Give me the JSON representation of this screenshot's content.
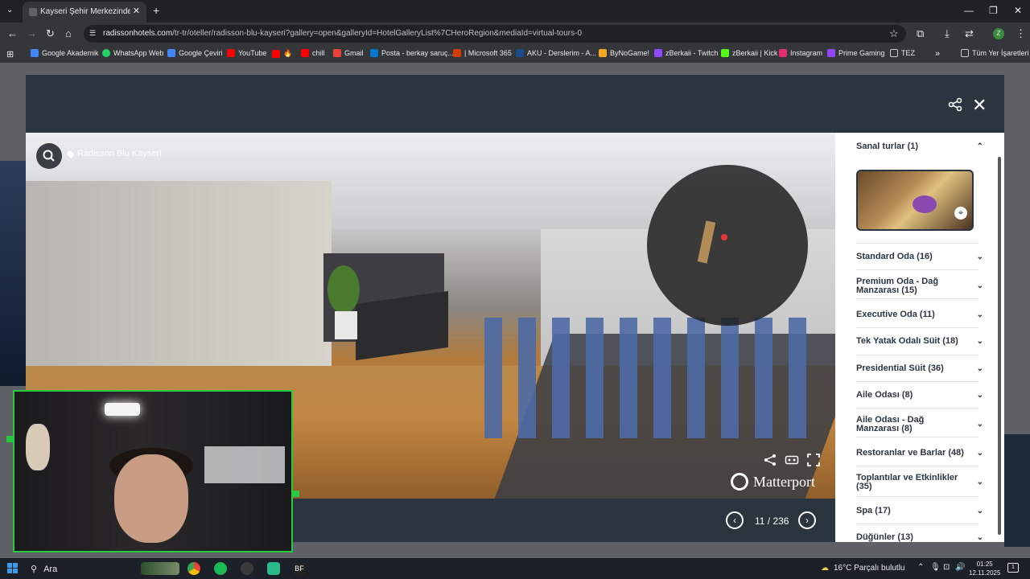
{
  "browser": {
    "tab_title": "Kayseri Şehir Merkezindeki Ot",
    "new_tab": "+",
    "url_host": "radissonhotels.com",
    "url_path": "/tr-tr/oteller/radisson-blu-kayseri?gallery=open&galleryId=HotelGalleryList%7CHeroRegion&mediaId=virtual-tours-0",
    "profile_initial": "Z"
  },
  "bookmarks": [
    {
      "label": "Google Akademik",
      "icon": "google-scholar-icon",
      "color": "#4285f4"
    },
    {
      "label": "WhatsApp Web",
      "icon": "whatsapp-icon",
      "color": "#25d366"
    },
    {
      "label": "Google Çeviri",
      "icon": "google-translate-icon",
      "color": "#4285f4"
    },
    {
      "label": "YouTube",
      "icon": "youtube-icon",
      "color": "#ff0000"
    },
    {
      "label": "🔥",
      "icon": "youtube-icon",
      "color": "#ff0000"
    },
    {
      "label": "chill",
      "icon": "youtube-icon",
      "color": "#ff0000"
    },
    {
      "label": "Gmail",
      "icon": "gmail-icon",
      "color": "#ea4335"
    },
    {
      "label": "Posta - berkay saruç...",
      "icon": "outlook-icon",
      "color": "#0078d4"
    },
    {
      "label": "| Microsoft 365",
      "icon": "microsoft-365-icon",
      "color": "#d83b01"
    },
    {
      "label": "AKU - Derslerim - A...",
      "icon": "aku-icon",
      "color": "#1a4c8b"
    },
    {
      "label": "ByNoGame!",
      "icon": "bynogame-icon",
      "color": "#f5a623"
    },
    {
      "label": "zBerkaii - Twitch",
      "icon": "twitch-icon",
      "color": "#9146ff"
    },
    {
      "label": "zBerkaii | Kick",
      "icon": "kick-icon",
      "color": "#53fc18"
    },
    {
      "label": "Instagram",
      "icon": "instagram-icon",
      "color": "#e1306c"
    },
    {
      "label": "Prime Gaming",
      "icon": "prime-gaming-icon",
      "color": "#9146ff"
    },
    {
      "label": "TEZ",
      "icon": "folder-icon",
      "color": "#c8c8c8"
    }
  ],
  "bookmarks_more": "»",
  "bookmarks_all": "Tüm Yer İşaretleri",
  "viewer": {
    "location": "Radisson Blu Kayseri",
    "brand": "Matterport",
    "counter": "11 / 236"
  },
  "sidebar": {
    "items": [
      {
        "label": "Sanal turlar (1)",
        "expanded": true
      },
      {
        "label": "Standard Oda (16)"
      },
      {
        "label": "Premium Oda - Dağ Manzarası (15)"
      },
      {
        "label": "Executive Oda (11)"
      },
      {
        "label": "Tek Yatak Odalı Süit (18)"
      },
      {
        "label": "Presidential Süit (36)"
      },
      {
        "label": "Aile Odası (8)"
      },
      {
        "label": "Aile Odası - Dağ Manzarası (8)"
      },
      {
        "label": "Restoranlar ve Barlar (48)"
      },
      {
        "label": "Toplantılar ve Etkinlikler (35)"
      },
      {
        "label": "Spa (17)"
      },
      {
        "label": "Düğünler (13)"
      }
    ]
  },
  "taskbar": {
    "search": "Ara",
    "weather": "16°C  Parçalı bulutlu",
    "time": "01:25",
    "date": "12.11.2025",
    "notifications": "1"
  },
  "colors": {
    "modal_header": "#2b353f",
    "accent_green": "#27c93f"
  }
}
